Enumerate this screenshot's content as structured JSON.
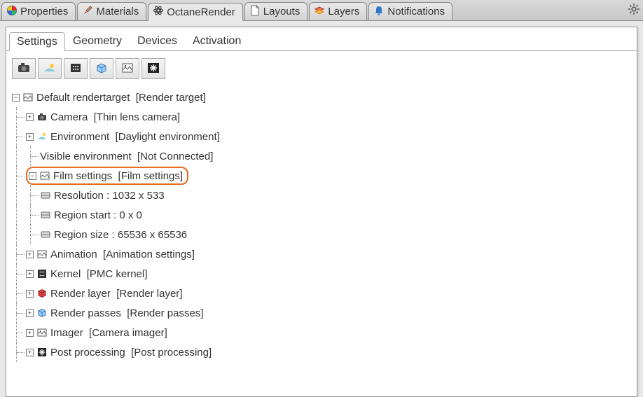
{
  "main_tabs": {
    "properties": "Properties",
    "materials": "Materials",
    "octane": "OctaneRender",
    "layouts": "Layouts",
    "layers": "Layers",
    "notifications": "Notifications"
  },
  "sub_tabs": {
    "settings": "Settings",
    "geometry": "Geometry",
    "devices": "Devices",
    "activation": "Activation"
  },
  "tree": {
    "root": {
      "name": "Default rendertarget",
      "type": "[Render target]"
    },
    "camera": {
      "name": "Camera",
      "type": "[Thin lens camera]"
    },
    "environment": {
      "name": "Environment",
      "type": "[Daylight environment]"
    },
    "visible_env": {
      "name": "Visible environment",
      "type": "[Not Connected]"
    },
    "film": {
      "name": "Film settings",
      "type": "[Film settings]"
    },
    "resolution": {
      "label": "Resolution : 1032 x 533"
    },
    "region_start": {
      "label": "Region start : 0 x 0"
    },
    "region_size": {
      "label": "Region size : 65536 x 65536"
    },
    "animation": {
      "name": "Animation",
      "type": "[Animation settings]"
    },
    "kernel": {
      "name": "Kernel",
      "type": "[PMC kernel]"
    },
    "render_layer": {
      "name": "Render layer",
      "type": "[Render layer]"
    },
    "render_passes": {
      "name": "Render passes",
      "type": "[Render passes]"
    },
    "imager": {
      "name": "Imager",
      "type": "[Camera imager]"
    },
    "post": {
      "name": "Post processing",
      "type": "[Post processing]"
    }
  }
}
